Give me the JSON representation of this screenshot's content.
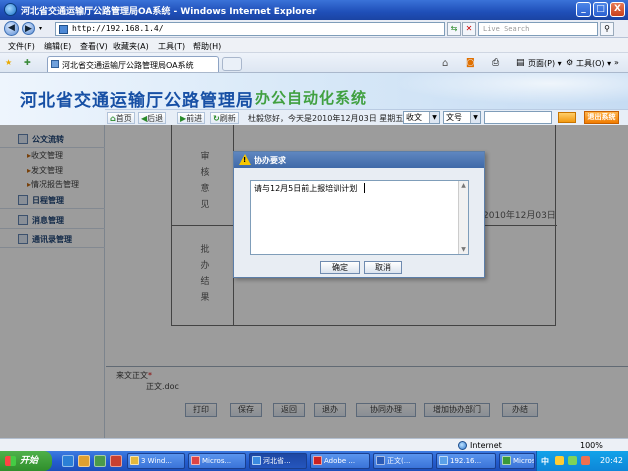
{
  "window": {
    "title": "河北省交通运输厅公路管理局OA系统 - Windows Internet Explorer",
    "minimize": "_",
    "maximize": "□",
    "close": "X"
  },
  "addressbar": {
    "url": "http://192.168.1.4/",
    "search_placeholder": "Live Search"
  },
  "menu": [
    "文件(F)",
    "编辑(E)",
    "查看(V)",
    "收藏夹(A)",
    "工具(T)",
    "帮助(H)"
  ],
  "tab": {
    "label": "河北省交通运输厅公路管理局OA系统"
  },
  "commands": {
    "page": "页面(P) ▾",
    "tools": "工具(O) ▾"
  },
  "header": {
    "org": "河北省交通运输厅公路管理局",
    "system": "办公自动化系统",
    "nav": {
      "home": "首页",
      "back": "后退",
      "forward": "前进",
      "refresh": "刷新"
    },
    "greeting": "杜毅您好，今天是2010年12月03日 星期五",
    "filter1": "收文",
    "filter2": "文号",
    "exit": "退出系统"
  },
  "sidebar": {
    "sections": [
      {
        "label": "公文流转",
        "icon": "document-icon"
      },
      {
        "label": "日程管理",
        "icon": "calendar-icon"
      },
      {
        "label": "消息管理",
        "icon": "message-icon"
      },
      {
        "label": "通讯录管理",
        "icon": "contacts-icon"
      }
    ],
    "subitems": [
      "收文管理",
      "发文管理",
      "情况报告管理"
    ]
  },
  "content": {
    "review_label": "审核意见",
    "approve_label": "批办结果",
    "date": "2010年12月03日",
    "attachment_label": "来文正文",
    "attachment_required": "*",
    "attachment_file": "正文.doc",
    "buttons": [
      "打印",
      "保存",
      "返回",
      "退办",
      "协同办理",
      "增加协办部门",
      "办结"
    ]
  },
  "modal": {
    "title": "协办要求",
    "text": "请与12月5日前上报培训计划",
    "ok": "确定",
    "cancel": "取消"
  },
  "statusbar": {
    "zone": "Internet",
    "zoom": "100%"
  },
  "taskbar": {
    "start": "开始",
    "items": [
      "3 Wind...",
      "Micros...",
      "河北省...",
      "Adobe ...",
      "正文(...",
      "192.16...",
      "Micros..."
    ],
    "clock": "20:42",
    "ime": "中"
  }
}
